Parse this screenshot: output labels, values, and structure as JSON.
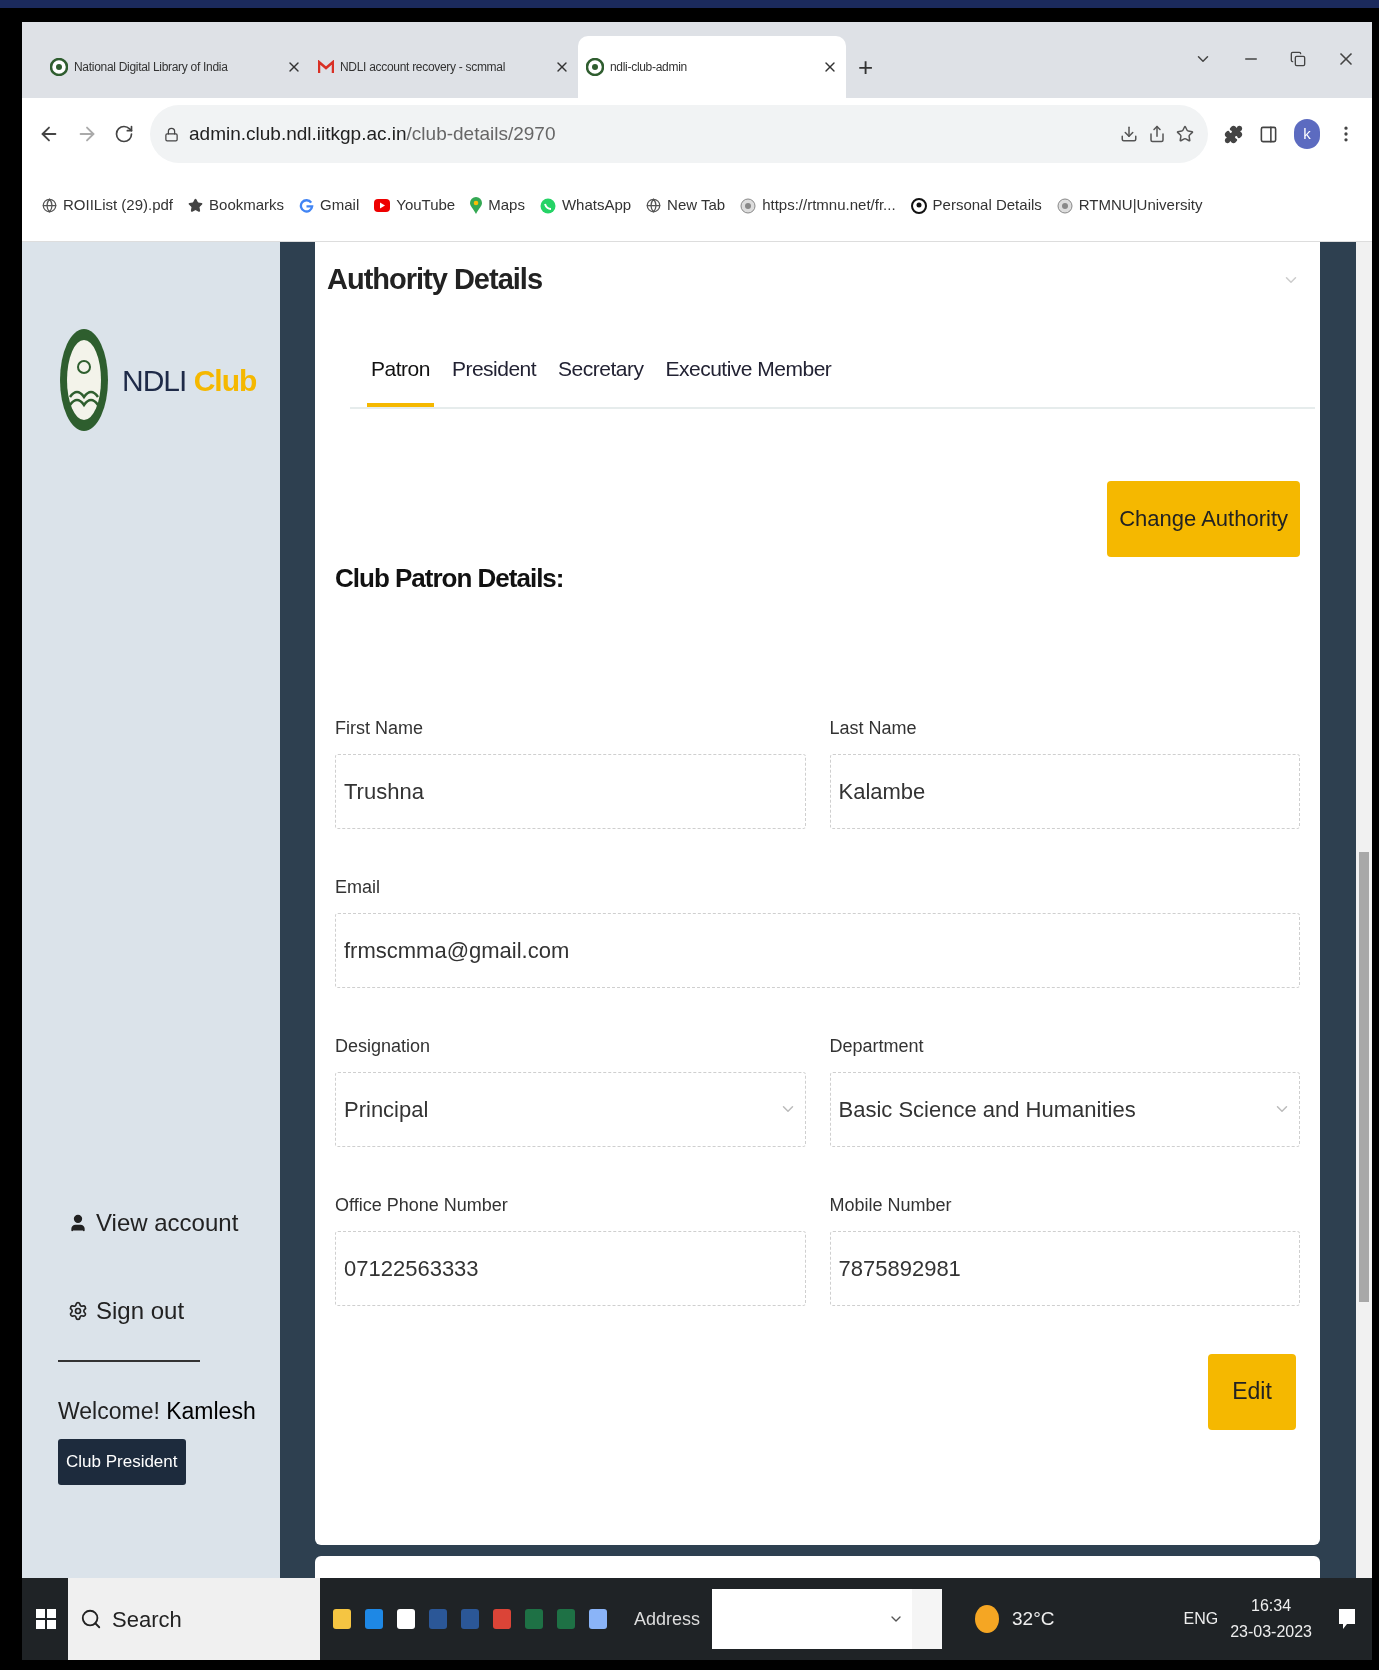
{
  "browser": {
    "tabs": [
      {
        "title": "National Digital Library of India",
        "selected": false
      },
      {
        "title": "NDLI account recovery - scmmal",
        "selected": false
      },
      {
        "title": "ndli-club-admin",
        "selected": true
      }
    ],
    "new_tab": "+",
    "url_host": "admin.club.ndl.iitkgp.ac.in",
    "url_path": "/club-details/2970",
    "avatar": "k",
    "bookmarks": [
      "ROIIList (29).pdf",
      "Bookmarks",
      "Gmail",
      "YouTube",
      "Maps",
      "WhatsApp",
      "New Tab",
      "https://rtmnu.net/fr...",
      "Personal Details",
      "RTMNU|University"
    ]
  },
  "sidebar": {
    "brand": "NDLI",
    "brand_accent": "Club",
    "nav": [
      {
        "label": "View account",
        "kind": "account"
      },
      {
        "label": "Sign out",
        "kind": "signout"
      }
    ],
    "welcome": "Welcome!",
    "user": "Kamlesh",
    "role": "Club President"
  },
  "main": {
    "title": "Authority Details",
    "tabs": [
      {
        "label": "Patron",
        "selected": true
      },
      {
        "label": "President",
        "selected": false
      },
      {
        "label": "Secretary",
        "selected": false
      },
      {
        "label": "Executive Member",
        "selected": false
      }
    ],
    "change_button": "Change Authority",
    "heading": "Club Patron Details:",
    "fields": [
      {
        "label": "First Name",
        "value": "Trushna",
        "kind": "text"
      },
      {
        "label": "Last Name",
        "value": "Kalambe",
        "kind": "text"
      },
      {
        "label": "Email",
        "value": "frmscmma@gmail.com",
        "kind": "email"
      },
      {
        "label": "Designation",
        "value": "Principal",
        "kind": "select"
      },
      {
        "label": "Department",
        "value": "Basic Science and Humanities",
        "kind": "select"
      },
      {
        "label": "Office Phone Number",
        "value": "07122563333",
        "kind": "text"
      },
      {
        "label": "Mobile Number",
        "value": "7875892981",
        "kind": "text"
      }
    ],
    "edit_button": "Edit"
  },
  "taskbar": {
    "search": "Search",
    "address_label": "Address",
    "temperature": "32°C",
    "language": "ENG",
    "time": "16:34",
    "date": "23-03-2023"
  }
}
